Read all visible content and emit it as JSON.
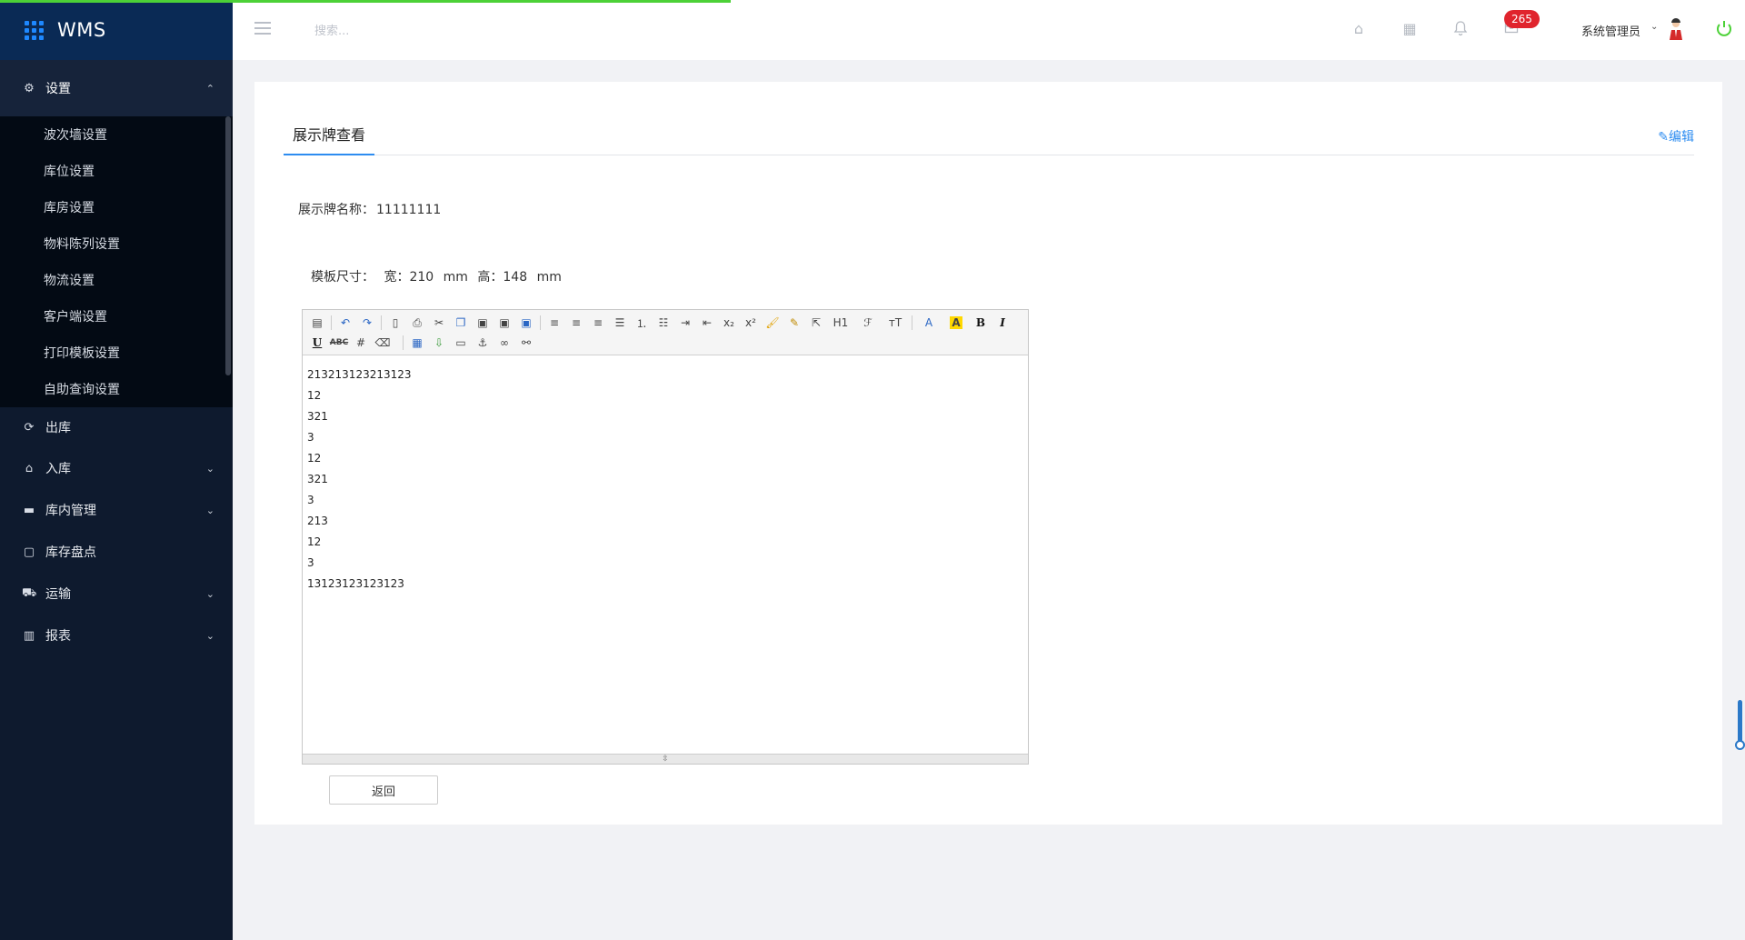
{
  "app": {
    "logo_text": "WMS"
  },
  "sidebar": {
    "active_group": {
      "label": "设置",
      "icon": "gear-icon",
      "chevron": "⌃"
    },
    "submenu": [
      {
        "label": "波次墙设置"
      },
      {
        "label": "库位设置"
      },
      {
        "label": "库房设置"
      },
      {
        "label": "物料陈列设置"
      },
      {
        "label": "物流设置"
      },
      {
        "label": "客户端设置"
      },
      {
        "label": "打印模板设置"
      },
      {
        "label": "自助查询设置"
      }
    ],
    "items": [
      {
        "label": "出库",
        "icon": "refresh-icon",
        "glyph": "⟳",
        "chevron": ""
      },
      {
        "label": "入库",
        "icon": "home-icon",
        "glyph": "⌂",
        "chevron": "⌄"
      },
      {
        "label": "库内管理",
        "icon": "box-icon",
        "glyph": "▬",
        "chevron": "⌄"
      },
      {
        "label": "库存盘点",
        "icon": "doc-search-icon",
        "glyph": "▢",
        "chevron": ""
      },
      {
        "label": "运输",
        "icon": "truck-icon",
        "glyph": "⛟",
        "chevron": "⌄"
      },
      {
        "label": "报表",
        "icon": "bar-chart-icon",
        "glyph": "▥",
        "chevron": "⌄"
      }
    ]
  },
  "header": {
    "search_placeholder": "搜索...",
    "badge_count": "265",
    "user_name": "系统管理员",
    "user_chevron": "⌄"
  },
  "page": {
    "tab_title": "展示牌查看",
    "edit_label": "✎编辑",
    "name_label": "展示牌名称：",
    "name_value": "11111111",
    "size_label": "模板尺寸：",
    "width_label": "宽：",
    "width_value": "210",
    "width_unit": "mm",
    "height_label": "高：",
    "height_value": "148",
    "height_unit": "mm",
    "back_label": "返回"
  },
  "editor": {
    "lines": [
      "213213123213123",
      "12",
      "321",
      "3",
      "12",
      "321",
      "3",
      "213",
      "12",
      "3",
      "13123123123123"
    ],
    "toolbar_text": {
      "h1": "H1",
      "font": "ℱ",
      "size": "тT",
      "font_color": "A",
      "bg_color": "A",
      "bold": "B",
      "italic": "I",
      "underline": "U",
      "strike": "ABC",
      "sub": "x₂",
      "sup": "x²"
    }
  }
}
